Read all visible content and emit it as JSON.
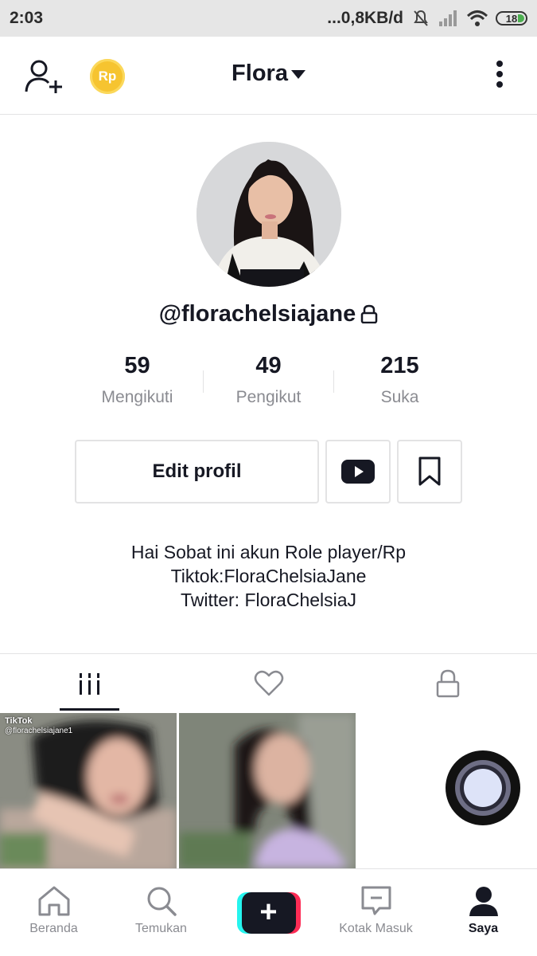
{
  "status_bar": {
    "time": "2:03",
    "network_speed": "...0,8KB/d",
    "battery": "18"
  },
  "header": {
    "add_user_icon": "add-user-icon",
    "coin_label": "Rp",
    "title": "Flora",
    "more_icon": "more-vertical-icon"
  },
  "profile": {
    "username": "@florachelsiajane",
    "stats": [
      {
        "value": "59",
        "label": "Mengikuti"
      },
      {
        "value": "49",
        "label": "Pengikut"
      },
      {
        "value": "215",
        "label": "Suka"
      }
    ],
    "edit_button": "Edit profil",
    "bio": [
      "Hai Sobat ini akun Role player/Rp",
      "Tiktok:FloraChelsiaJane",
      "Twitter: FloraChelsiaJ"
    ]
  },
  "tabs": [
    {
      "icon": "videos-grid-icon",
      "active": true
    },
    {
      "icon": "heart-icon",
      "active": false
    },
    {
      "icon": "lock-icon",
      "active": false
    }
  ],
  "videos": [
    {
      "watermark_brand": "TikTok",
      "watermark_user": "@florachelsiajane1"
    },
    {}
  ],
  "bottom_nav": [
    {
      "label": "Beranda",
      "icon": "home-icon",
      "active": false
    },
    {
      "label": "Temukan",
      "icon": "search-icon",
      "active": false
    },
    {
      "label": "",
      "icon": "create-plus-icon",
      "active": false
    },
    {
      "label": "Kotak Masuk",
      "icon": "inbox-icon",
      "active": false
    },
    {
      "label": "Saya",
      "icon": "profile-icon",
      "active": true
    }
  ],
  "colors": {
    "text_primary": "#161823",
    "text_secondary": "#8a8b91",
    "divider": "#e3e3e4",
    "coin": "#f6c430",
    "tiktok_cyan": "#25f4ee",
    "tiktok_pink": "#fe2c55"
  }
}
